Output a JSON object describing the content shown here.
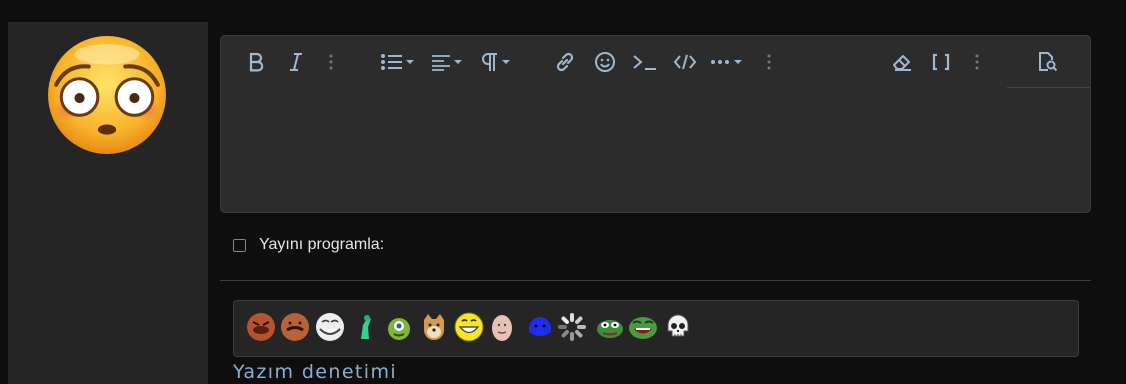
{
  "avatar": {
    "icon": "flushed-face-emoji"
  },
  "editor": {
    "toolbar": [
      {
        "name": "bold-button",
        "icon": "bold-icon"
      },
      {
        "name": "italic-button",
        "icon": "italic-icon"
      },
      {
        "name": "more-text-options-button",
        "icon": "vertical-ellipsis-icon"
      },
      {
        "name": "list-dropdown-button",
        "icon": "bullet-list-icon"
      },
      {
        "name": "align-dropdown-button",
        "icon": "align-left-icon"
      },
      {
        "name": "paragraph-dropdown-button",
        "icon": "paragraph-icon"
      },
      {
        "name": "link-button",
        "icon": "link-icon"
      },
      {
        "name": "emoji-button",
        "icon": "smile-icon"
      },
      {
        "name": "inline-code-button",
        "icon": "terminal-icon"
      },
      {
        "name": "code-block-button",
        "icon": "code-icon"
      },
      {
        "name": "insert-more-button",
        "icon": "horizontal-ellipsis-icon"
      },
      {
        "name": "more-insert-options-button",
        "icon": "vertical-ellipsis-icon"
      },
      {
        "name": "remove-formatting-button",
        "icon": "eraser-icon"
      },
      {
        "name": "toggle-bbcode-button",
        "icon": "brackets-icon"
      },
      {
        "name": "more-options-button",
        "icon": "vertical-ellipsis-icon"
      },
      {
        "name": "preview-button",
        "icon": "document-search-icon"
      }
    ],
    "body_text": ""
  },
  "schedule": {
    "label": "Yayını programla:",
    "checked": false
  },
  "smilies": [
    "angry-face-smiley",
    "mustache-face-smiley",
    "troll-face-smiley",
    "green-figure-smiley",
    "green-monster-smiley",
    "doge-smiley",
    "grinning-yellow-smiley",
    "bald-face-smiley",
    "blue-blob-smiley",
    "loading-spinner-smiley",
    "pepe-smiley",
    "laughing-pepe-smiley",
    "skull-smiley"
  ],
  "spellcheck": {
    "label": "Yazım denetimi"
  },
  "colors": {
    "accent": "#9fb8cf",
    "link": "#8aaed0",
    "background": "#0e0e0e",
    "panel": "#2c2c2c"
  }
}
